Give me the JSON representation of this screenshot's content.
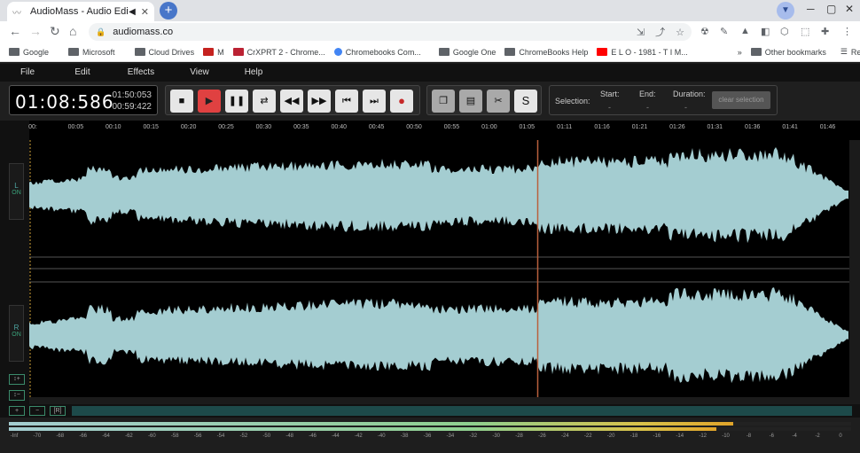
{
  "browser": {
    "tab_title": "AudioMass - Audio Editor",
    "url": "audiomass.co",
    "bookmarks": [
      {
        "label": "Google",
        "icon": "folder-icon"
      },
      {
        "label": "Microsoft",
        "icon": "folder-icon"
      },
      {
        "label": "Cloud Drives",
        "icon": "folder-icon"
      },
      {
        "label": "M",
        "icon": "gmail-icon"
      },
      {
        "label": "CrXPRT 2 - Chrome...",
        "icon": "crxprt-icon"
      },
      {
        "label": "Chromebooks Com...",
        "icon": "google-icon"
      },
      {
        "label": "Google One",
        "icon": "folder-icon"
      },
      {
        "label": "ChromeBooks Help",
        "icon": "folder-icon"
      },
      {
        "label": "E L O - 1981 - T I M...",
        "icon": "youtube-icon"
      }
    ],
    "other_bookmarks": "Other bookmarks",
    "reading_list": "Reading list"
  },
  "menu": [
    "File",
    "Edit",
    "Effects",
    "View",
    "Help"
  ],
  "time": {
    "current": "01:08:586",
    "total": "01:50:053",
    "remaining": "00:59:422"
  },
  "selection": {
    "label": "Selection:",
    "start_label": "Start:",
    "end_label": "End:",
    "duration_label": "Duration:",
    "start": "-",
    "end": "-",
    "duration": "-",
    "clear": "clear selection"
  },
  "edit_buttons": {
    "silence": "S"
  },
  "timeline_ticks": [
    "00:",
    "00:05",
    "00:10",
    "00:15",
    "00:20",
    "00:25",
    "00:30",
    "00:35",
    "00:40",
    "00:45",
    "00:50",
    "00:55",
    "01:00",
    "01:05",
    "01:11",
    "01:16",
    "01:21",
    "01:26",
    "01:31",
    "01:36",
    "01:41",
    "01:46"
  ],
  "channels": [
    {
      "label": "L",
      "state": "ON"
    },
    {
      "label": "R",
      "state": "ON"
    }
  ],
  "zoom": {
    "in": "+",
    "out": "−",
    "reset": "[R]"
  },
  "meter_scale": [
    "-Inf",
    "-70",
    "-68",
    "-66",
    "-64",
    "-62",
    "-60",
    "-58",
    "-56",
    "-54",
    "-52",
    "-50",
    "-48",
    "-46",
    "-44",
    "-42",
    "-40",
    "-38",
    "-36",
    "-34",
    "-32",
    "-30",
    "-28",
    "-26",
    "-24",
    "-22",
    "-20",
    "-18",
    "-16",
    "-14",
    "-12",
    "-10",
    "-8",
    "-6",
    "-4",
    "-2",
    "0"
  ],
  "playhead_position": 0.62,
  "colors": {
    "waveform": "#a4cdd1",
    "playhead": "#b9603d",
    "accent": "#e04141"
  }
}
